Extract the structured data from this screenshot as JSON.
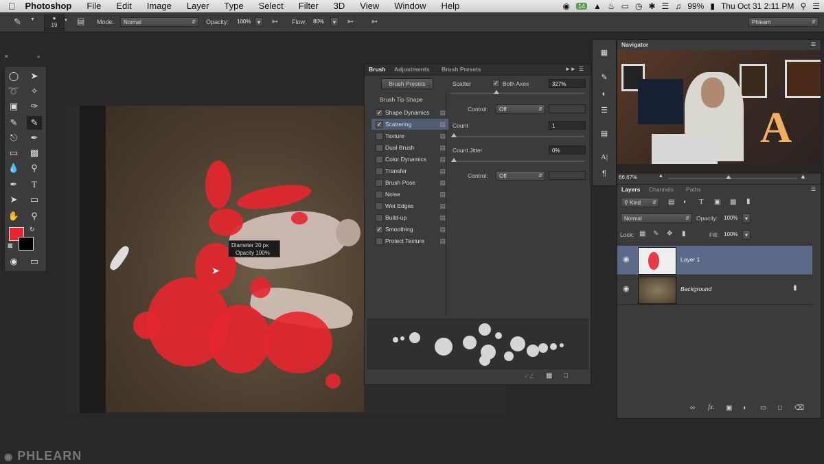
{
  "menubar": {
    "app": "Photoshop",
    "items": [
      "File",
      "Edit",
      "Image",
      "Layer",
      "Type",
      "Select",
      "Filter",
      "3D",
      "View",
      "Window",
      "Help"
    ],
    "battery": "99%",
    "clock": "Thu Oct 31  2:11 PM",
    "badge": "14"
  },
  "options": {
    "brush_size": "19",
    "mode_label": "Mode:",
    "mode_value": "Normal",
    "opacity_label": "Opacity:",
    "opacity_value": "100%",
    "flow_label": "Flow:",
    "flow_value": "80%",
    "workspace": "Phlearn"
  },
  "tooltip": {
    "diameter": "Diameter  20 px",
    "opacity": "Opacity  100%"
  },
  "brush_panel": {
    "tabs": [
      "Brush",
      "Adjustments",
      "Brush Presets"
    ],
    "presets_button": "Brush Presets",
    "tip_shape": "Brush Tip Shape",
    "options": [
      {
        "label": "Shape Dynamics",
        "checked": true
      },
      {
        "label": "Scattering",
        "checked": true,
        "selected": true
      },
      {
        "label": "Texture",
        "checked": false
      },
      {
        "label": "Dual Brush",
        "checked": false
      },
      {
        "label": "Color Dynamics",
        "checked": false
      },
      {
        "label": "Transfer",
        "checked": false
      },
      {
        "label": "Brush Pose",
        "checked": false
      },
      {
        "label": "Noise",
        "checked": false
      },
      {
        "label": "Wet Edges",
        "checked": false
      },
      {
        "label": "Build-up",
        "checked": false
      },
      {
        "label": "Smoothing",
        "checked": true
      },
      {
        "label": "Protect Texture",
        "checked": false
      }
    ],
    "scatter_label": "Scatter",
    "both_axes": "Both Axes",
    "scatter_value": "327%",
    "control_label": "Control:",
    "control1_value": "Off",
    "count_label": "Count",
    "count_value": "1",
    "count_jitter_label": "Count Jitter",
    "count_jitter_value": "0%",
    "control2_value": "Off"
  },
  "navigator": {
    "title": "Navigator",
    "zoom": "66.67%",
    "sign_letter": "A"
  },
  "layers": {
    "tabs": [
      "Layers",
      "Channels",
      "Paths"
    ],
    "kind": "Kind",
    "blend": "Normal",
    "opacity_label": "Opacity:",
    "opacity_value": "100%",
    "lock_label": "Lock:",
    "fill_label": "Fill:",
    "fill_value": "100%",
    "rows": [
      {
        "name": "Layer 1",
        "selected": true
      },
      {
        "name": "Background",
        "selected": false
      }
    ]
  },
  "watermark": "PHLEARN",
  "colors": {
    "foreground": "#e6262f",
    "background": "#000000",
    "selected_layer": "#5b6a8a",
    "selected_option": "#4f5d75"
  }
}
